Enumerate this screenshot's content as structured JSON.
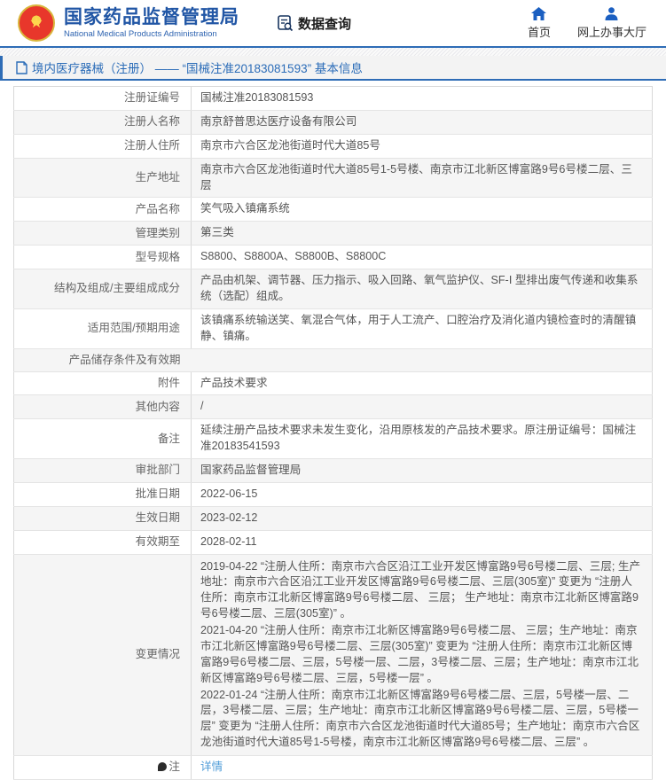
{
  "header": {
    "org_name_zh": "国家药品监督管理局",
    "org_name_en": "National Medical Products Administration",
    "data_query_label": "数据查询",
    "nav": [
      {
        "label": "首页",
        "icon": "home-icon"
      },
      {
        "label": "网上办事大厅",
        "icon": "person-icon"
      }
    ]
  },
  "page_title": "境内医疗器械（注册） —— “国械注准20183081593” 基本信息",
  "colors": {
    "accent_blue": "#2e6cb6",
    "org_blue": "#2156a5",
    "link_blue": "#4f9cd8",
    "row_alt_bg": "#f5f5f5",
    "border_gray": "#d8d8d8"
  },
  "table": {
    "rows": [
      {
        "label": "注册证编号",
        "value": "国械注准20183081593"
      },
      {
        "label": "注册人名称",
        "value": "南京舒普思达医疗设备有限公司"
      },
      {
        "label": "注册人住所",
        "value": "南京市六合区龙池街道时代大道85号"
      },
      {
        "label": "生产地址",
        "value": "南京市六合区龙池街道时代大道85号1-5号楼、南京市江北新区博富路9号6号楼二层、三层"
      },
      {
        "label": "产品名称",
        "value": "笑气吸入镇痛系统"
      },
      {
        "label": "管理类别",
        "value": "第三类"
      },
      {
        "label": "型号规格",
        "value": "S8800、S8800A、S8800B、S8800C"
      },
      {
        "label": "结构及组成/主要组成成分",
        "value": "产品由机架、调节器、压力指示、吸入回路、氧气监护仪、SF-Ⅰ 型排出废气传递和收集系统（选配）组成。"
      },
      {
        "label": "适用范围/预期用途",
        "value": "该镇痛系统输送笑、氧混合气体，用于人工流产、口腔治疗及消化道内镜检查时的清醒镇静、镇痛。"
      },
      {
        "label": "产品储存条件及有效期",
        "value": "",
        "empty": true
      },
      {
        "label": "附件",
        "value": "产品技术要求"
      },
      {
        "label": "其他内容",
        "value": "/"
      },
      {
        "label": "备注",
        "value": "延续注册产品技术要求未发生变化，沿用原核发的产品技术要求。原注册证编号：国械注准20183541593"
      },
      {
        "label": "审批部门",
        "value": "国家药品监督管理局"
      },
      {
        "label": "批准日期",
        "value": "2022-06-15"
      },
      {
        "label": "生效日期",
        "value": "2023-02-12"
      },
      {
        "label": "有效期至",
        "value": "2028-02-11"
      },
      {
        "label": "变更情况",
        "paragraphs": [
          "2019-04-22  “注册人住所：南京市六合区沿江工业开发区博富路9号6号楼二层、三层; 生产地址：南京市六合区沿江工业开发区博富路9号6号楼二层、三层(305室)” 变更为 “注册人住所：南京市江北新区博富路9号6号楼二层、 三层； 生产地址：南京市江北新区博富路9号6号楼二层、三层(305室)” 。",
          "2021-04-20  “注册人住所：南京市江北新区博富路9号6号楼二层、 三层；生产地址：南京市江北新区博富路9号6号楼二层、三层(305室)” 变更为 “注册人住所：南京市江北新区博富路9号6号楼二层、三层，5号楼一层、二层，3号楼二层、三层；生产地址：南京市江北新区博富路9号6号楼二层、三层，5号楼一层” 。",
          "2022-01-24  “注册人住所：南京市江北新区博富路9号6号楼二层、三层，5号楼一层、二层，3号楼二层、三层；生产地址：南京市江北新区博富路9号6号楼二层、三层，5号楼一层” 变更为 “注册人住所：南京市六合区龙池街道时代大道85号；生产地址：南京市六合区龙池街道时代大道85号1-5号楼，南京市江北新区博富路9号6号楼二层、三层” 。"
        ]
      },
      {
        "label": "注",
        "note_icon": true,
        "link": "详情"
      }
    ]
  }
}
